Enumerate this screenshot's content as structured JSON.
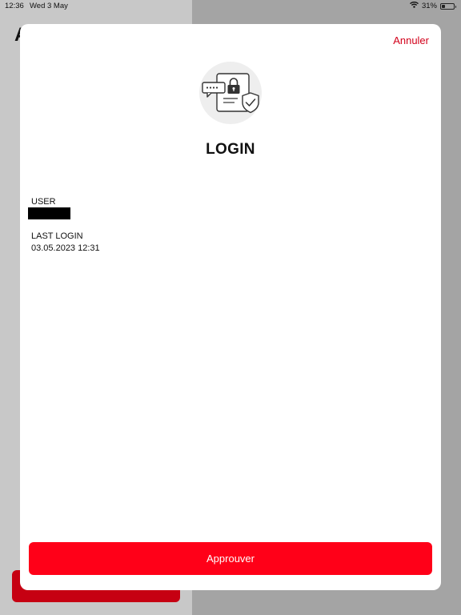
{
  "status_bar": {
    "time": "12:36",
    "date": "Wed 3 May",
    "battery_text": "31%",
    "battery_level": 0.31,
    "wifi_icon": "wifi-icon",
    "battery_icon": "battery-icon"
  },
  "background": {
    "title_fragment": "A"
  },
  "sheet": {
    "cancel_label": "Annuler",
    "illustration_icon": "secure-login-icon",
    "title": "LOGIN",
    "user_label": "USER",
    "last_login_label": "LAST LOGIN",
    "last_login_value": "03.05.2023 12:31",
    "approve_label": "Approuver"
  },
  "colors": {
    "accent_red": "#ff0018",
    "cancel_red": "#d2001a",
    "bg_button_red": "#c60012"
  }
}
